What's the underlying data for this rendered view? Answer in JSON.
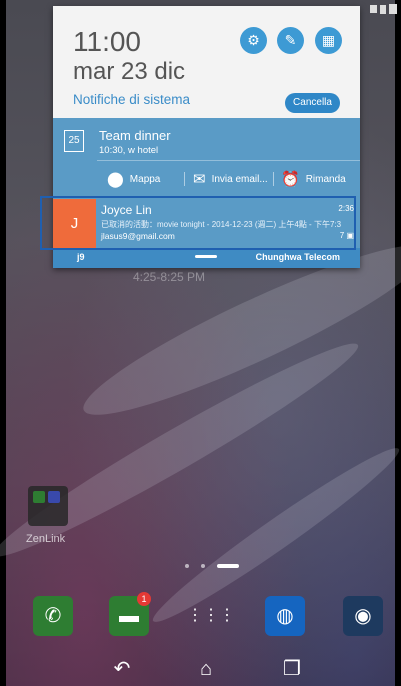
{
  "status": {
    "icons": [
      "screenshot-icon",
      "signal-icon",
      "battery-icon"
    ]
  },
  "shade": {
    "clock": "11:00",
    "date": "mar 23 dic",
    "system_notifications_label": "Notifiche di sistema",
    "cancel_label": "Cancella",
    "quick_buttons": [
      "settings-icon",
      "edit-notes-icon",
      "qr-scan-icon"
    ],
    "accent_color": "#3d9ad4"
  },
  "calendar_notification": {
    "icon_day": "25",
    "title": "Team dinner",
    "subtitle": "10:30, w hotel",
    "actions": [
      {
        "label": "Mappa",
        "icon": "map-pin-icon"
      },
      {
        "label": "Invia email...",
        "icon": "envelope-icon"
      },
      {
        "label": "Rimanda",
        "icon": "alarm-icon"
      }
    ]
  },
  "mail_notification": {
    "avatar_letter": "J",
    "sender": "Joyce Lin",
    "time": "2:36",
    "snippet": "已取消的活動：movie tonight - 2014-12-23 (週二) 上午4點 - 下午7:3",
    "account": "jlasus9@gmail.com",
    "count": "7",
    "avatar_color": "#ef6b3b"
  },
  "carrier": {
    "left": "j9",
    "right": "Chunghwa Telecom"
  },
  "home": {
    "faded_time": "4:25-8:25 PM",
    "folder_label": "ZenLink",
    "messages_badge": "1"
  },
  "dock": [
    "phone-icon",
    "messages-icon",
    "app-drawer-icon",
    "browser-icon",
    "camera-icon"
  ],
  "navbar": [
    "back-icon",
    "home-icon",
    "recents-icon"
  ]
}
